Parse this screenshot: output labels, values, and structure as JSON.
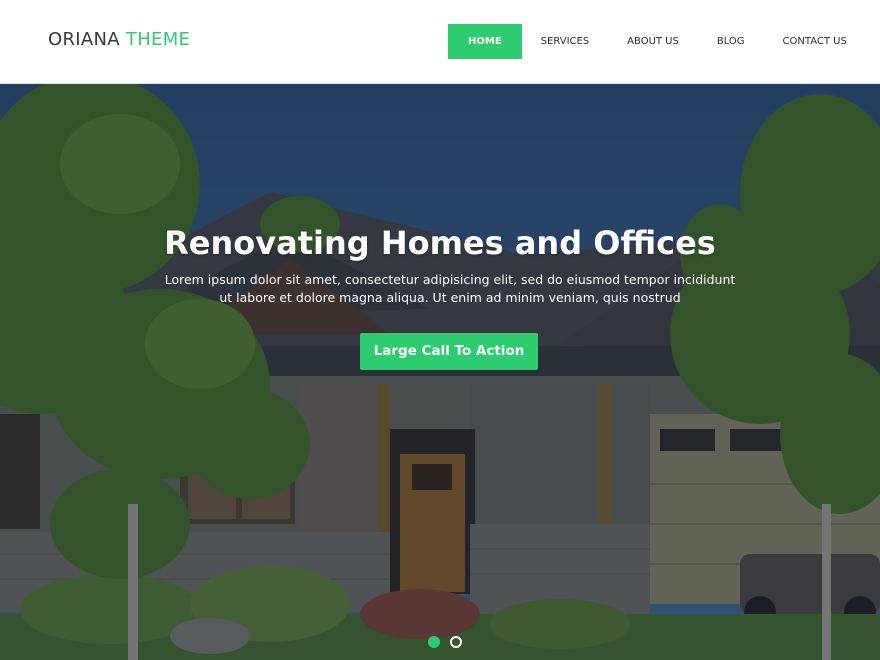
{
  "brand": {
    "name_part1": "ORIANA",
    "name_part2": "THEME"
  },
  "nav": {
    "items": [
      {
        "label": "HOME",
        "active": true
      },
      {
        "label": "SERVICES",
        "active": false
      },
      {
        "label": "ABOUT US",
        "active": false
      },
      {
        "label": "BLOG",
        "active": false
      },
      {
        "label": "CONTACT US",
        "active": false
      }
    ]
  },
  "hero": {
    "title": "Renovating Homes and Offices",
    "text": "Lorem ipsum dolor sit amet, consectetur adipisicing elit, sed do eiusmod tempor incididunt ut labore et dolore magna aliqua. Ut enim ad minim veniam, quis nostrud",
    "cta_label": "Large Call To Action",
    "slides": {
      "count": 2,
      "active_index": 0
    }
  },
  "colors": {
    "accent": "#2ecc71",
    "header_bg": "#ffffff",
    "hero_overlay": "#121c2c"
  }
}
